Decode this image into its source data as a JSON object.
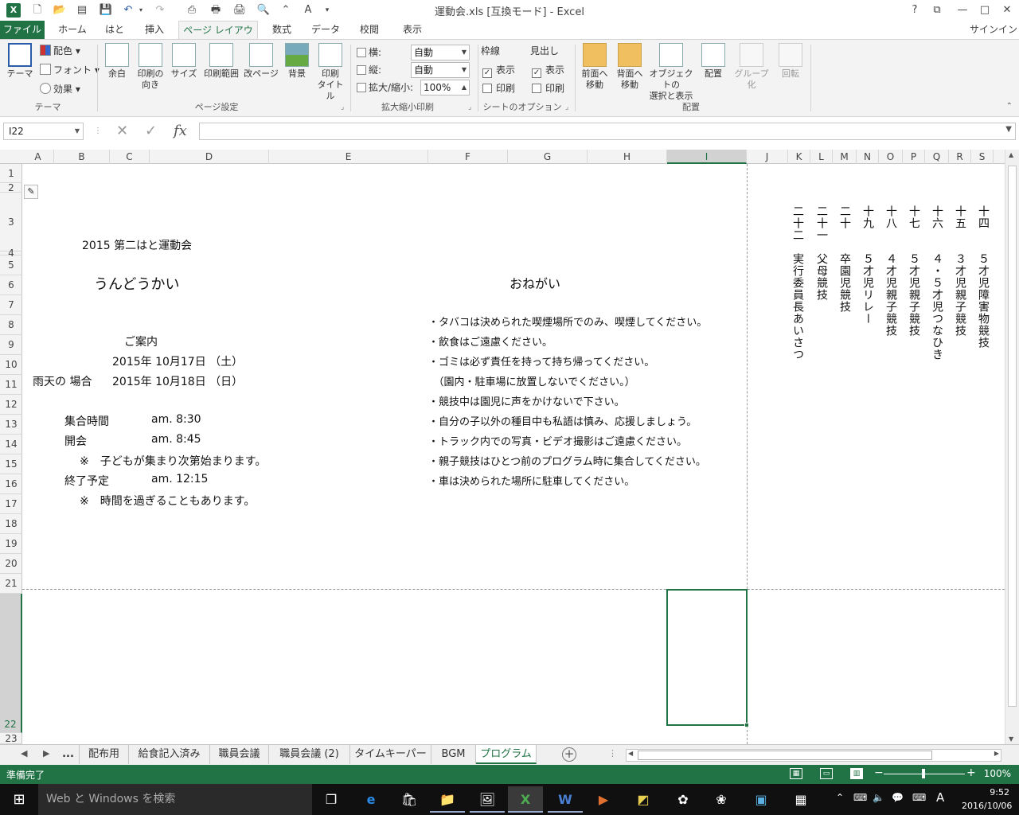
{
  "window": {
    "title": "運動会.xls [互換モード] - Excel"
  },
  "quick_access": {
    "undo": "↶",
    "redo": "↷",
    "help": "?",
    "restore": "⧉",
    "minimize": "—",
    "maximize": "□",
    "close": "✕",
    "app": "X",
    "font_a": "A"
  },
  "tabs": {
    "file": "ファイル",
    "home": "ホーム",
    "hato": "はと",
    "insert": "挿入",
    "page_layout": "ページ レイアウト",
    "formulas": "数式",
    "data": "データ",
    "review": "校閲",
    "view": "表示",
    "signin": "サインイン"
  },
  "ribbon": {
    "theme": {
      "themes": "テーマ",
      "colors": "配色",
      "fonts": "フォント",
      "effects": "効果",
      "group": "テーマ"
    },
    "page_setup": {
      "margins": "余白",
      "orientation_1": "印刷の",
      "orientation_2": "向き",
      "size": "サイズ",
      "print_area": "印刷範囲",
      "breaks": "改ページ",
      "background": "背景",
      "print_titles_1": "印刷",
      "print_titles_2": "タイトル",
      "group": "ページ設定"
    },
    "scale": {
      "width_label": "横:",
      "width_value": "自動",
      "height_label": "縦:",
      "height_value": "自動",
      "scale_label": "拡大/縮小:",
      "scale_value": "100%",
      "group": "拡大縮小印刷"
    },
    "sheet_options": {
      "gridlines": "枠線",
      "headings": "見出し",
      "view": "表示",
      "print": "印刷",
      "group": "シートのオプション"
    },
    "arrange": {
      "bring_forward_1": "前面へ",
      "bring_forward_2": "移動",
      "send_backward_1": "背面へ",
      "send_backward_2": "移動",
      "selection_1": "オブジェクトの",
      "selection_2": "選択と表示",
      "align": "配置",
      "group_btn": "グループ化",
      "rotate": "回転",
      "group": "配置"
    }
  },
  "formula_bar": {
    "name_box": "I22",
    "fx": "fx",
    "cancel": "✕",
    "enter": "✓",
    "value": ""
  },
  "columns": [
    "A",
    "B",
    "C",
    "D",
    "E",
    "F",
    "G",
    "H",
    "I",
    "J",
    "K",
    "L",
    "M",
    "N",
    "O",
    "P",
    "Q",
    "R",
    "S"
  ],
  "rows": [
    "1",
    "2",
    "3",
    "4",
    "5",
    "6",
    "7",
    "8",
    "9",
    "10",
    "11",
    "12",
    "13",
    "14",
    "15",
    "16",
    "17",
    "18",
    "19",
    "20",
    "21",
    "22",
    "23"
  ],
  "sheet": {
    "b3": "2015 第二はと運動会",
    "b6": "うんどうかい",
    "c9": "ご案内",
    "c10": "2015年 10月17日 （土）",
    "a11": "雨天の 場合",
    "c11": "2015年 10月18日 （日）",
    "b13": "集合時間",
    "d13": "am. 8:30",
    "b14": "開会",
    "d14": "am. 8:45",
    "b15": "※　子どもが集まり次第始まります。",
    "b16": "終了予定",
    "d16": "am. 12:15",
    "b17": "※　時間を過ぎることもあります。",
    "g6": "おねがい",
    "notes": [
      "・タバコは決められた喫煙場所でのみ、喫煙してください。",
      "・飲食はご遠慮ください。",
      "・ゴミは必ず責任を持って持ち帰ってください。",
      "　（園内・駐車場に放置しないでください。）",
      "・競技中は園児に声をかけないで下さい。",
      "・自分の子以外の種目中も私語は慎み、応援しましょう。",
      "・トラック内での写真・ビデオ撮影はご遠慮ください。",
      "・親子競技はひとつ前のプログラム時に集合してください。",
      "・車は決められた場所に駐車してください。"
    ],
    "program": [
      {
        "no": "二十二",
        "title": "実行委員長あいさつ"
      },
      {
        "no": "二十一",
        "title": "父母競技"
      },
      {
        "no": "二十",
        "title": "卒園児競技"
      },
      {
        "no": "十九",
        "title": "５才児リレー"
      },
      {
        "no": "十八",
        "title": "４才児親子競技"
      },
      {
        "no": "十七",
        "title": "５才児親子競技"
      },
      {
        "no": "十六",
        "title": "４・５才児つなひき"
      },
      {
        "no": "十五",
        "title": "３才児親子競技"
      },
      {
        "no": "十四",
        "title": "５才児障害物競技"
      }
    ]
  },
  "sheet_tabs": {
    "more": "...",
    "items": [
      "配布用",
      "給食記入済み",
      "職員会議",
      "職員会議 (2)",
      "タイムキーパー",
      "BGM",
      "プログラム"
    ],
    "active": "プログラム"
  },
  "status": {
    "ready": "準備完了",
    "zoom": "100%"
  },
  "taskbar": {
    "search": "Web と Windows を検索",
    "time": "9:52",
    "date": "2016/10/06",
    "ime": "A"
  }
}
